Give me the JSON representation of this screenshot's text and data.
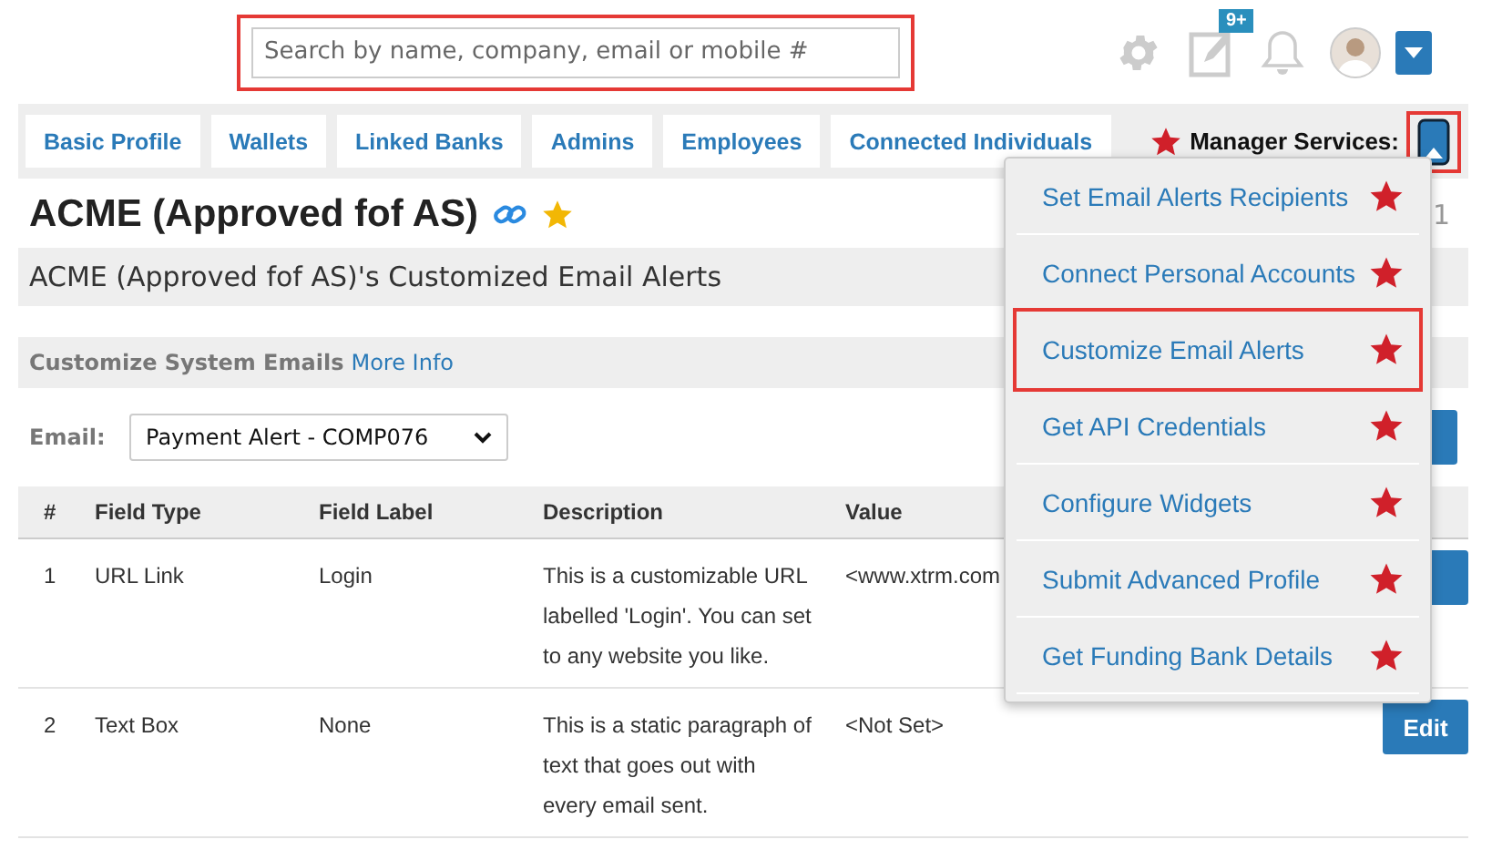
{
  "header": {
    "search": {
      "placeholder": "Search by name, company, email or mobile #",
      "highlighted": true
    },
    "notes_badge": "9+"
  },
  "tabs": [
    {
      "label": "Basic Profile",
      "selected": false
    },
    {
      "label": "Wallets",
      "selected": false
    },
    {
      "label": "Linked Banks",
      "selected": false
    },
    {
      "label": "Admins",
      "selected": false
    },
    {
      "label": "Employees",
      "selected": false
    },
    {
      "label": "Connected Individuals",
      "selected": false
    }
  ],
  "manager_services": {
    "label": "Manager Services:",
    "highlighted": true,
    "expanded": true
  },
  "title": "ACME (Approved fof AS)",
  "title_side_text": "1",
  "subtitle": "ACME (Approved fof AS)'s Customized Email Alerts",
  "section": {
    "title": "Customize System Emails",
    "link": "More Info"
  },
  "email": {
    "label": "Email:",
    "value": "Payment Alert - COMP076"
  },
  "table": {
    "columns": [
      "#",
      "Field Type",
      "Field Label",
      "Description",
      "Value"
    ],
    "rows": [
      {
        "cells": [
          "1",
          "URL Link",
          "Login",
          "This is a customizable URL labelled 'Login'. You can set to any website you like.",
          "<www.xtrm.com"
        ]
      },
      {
        "cells": [
          "2",
          "Text Box",
          "None",
          "This is a static paragraph of text that goes out with every email sent.",
          "<Not Set>"
        ],
        "action": "Edit"
      }
    ]
  },
  "menu": [
    {
      "label": "Set Email Alerts Recipients",
      "highlighted": false
    },
    {
      "label": "Connect Personal Accounts",
      "highlighted": false
    },
    {
      "label": "Customize Email Alerts",
      "highlighted": true
    },
    {
      "label": "Get API Credentials",
      "highlighted": false
    },
    {
      "label": "Configure Widgets",
      "highlighted": false
    },
    {
      "label": "Submit Advanced Profile",
      "highlighted": false
    },
    {
      "label": "Get Funding Bank Details",
      "highlighted": false
    }
  ]
}
